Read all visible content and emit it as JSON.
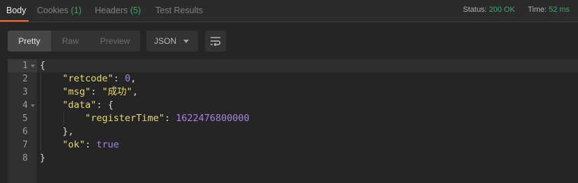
{
  "tabs": [
    {
      "label": "Body",
      "count": "",
      "active": true
    },
    {
      "label": "Cookies",
      "count": "(1)",
      "active": false
    },
    {
      "label": "Headers",
      "count": "(5)",
      "active": false
    },
    {
      "label": "Test Results",
      "count": "",
      "active": false
    }
  ],
  "status": {
    "status_label": "Status:",
    "status_value": "200 OK",
    "time_label": "Time:",
    "time_value": "52 ms"
  },
  "view_modes": {
    "pretty": "Pretty",
    "raw": "Raw",
    "preview": "Preview",
    "selected": "Pretty"
  },
  "format_dropdown": {
    "value": "JSON"
  },
  "toolbar_icons": {
    "wrap_icon": "wrap-lines-icon"
  },
  "editor": {
    "line_numbers": [
      "1",
      "2",
      "3",
      "4",
      "5",
      "6",
      "7",
      "8"
    ],
    "foldable_lines": [
      "1",
      "4"
    ],
    "lines": [
      {
        "text": "{"
      },
      {
        "key": "\"retcode\"",
        "sep": ": ",
        "value": "0",
        "value_type": "num",
        "tail": ","
      },
      {
        "key": "\"msg\"",
        "sep": ": ",
        "value": "\"成功\"",
        "value_type": "str",
        "tail": ","
      },
      {
        "key": "\"data\"",
        "sep": ": ",
        "value": "{",
        "value_type": "punc",
        "tail": ""
      },
      {
        "key": "\"registerTime\"",
        "sep": ": ",
        "value": "1622476800000",
        "value_type": "num",
        "tail": ""
      },
      {
        "text": "},"
      },
      {
        "key": "\"ok\"",
        "sep": ": ",
        "value": "true",
        "value_type": "bool",
        "tail": ""
      },
      {
        "text": "}"
      }
    ]
  },
  "colors": {
    "accent_tab_underline": "#f26b3a",
    "count_green": "#3fa66a",
    "json_key": "#e5d96b",
    "json_number": "#a584e0"
  }
}
